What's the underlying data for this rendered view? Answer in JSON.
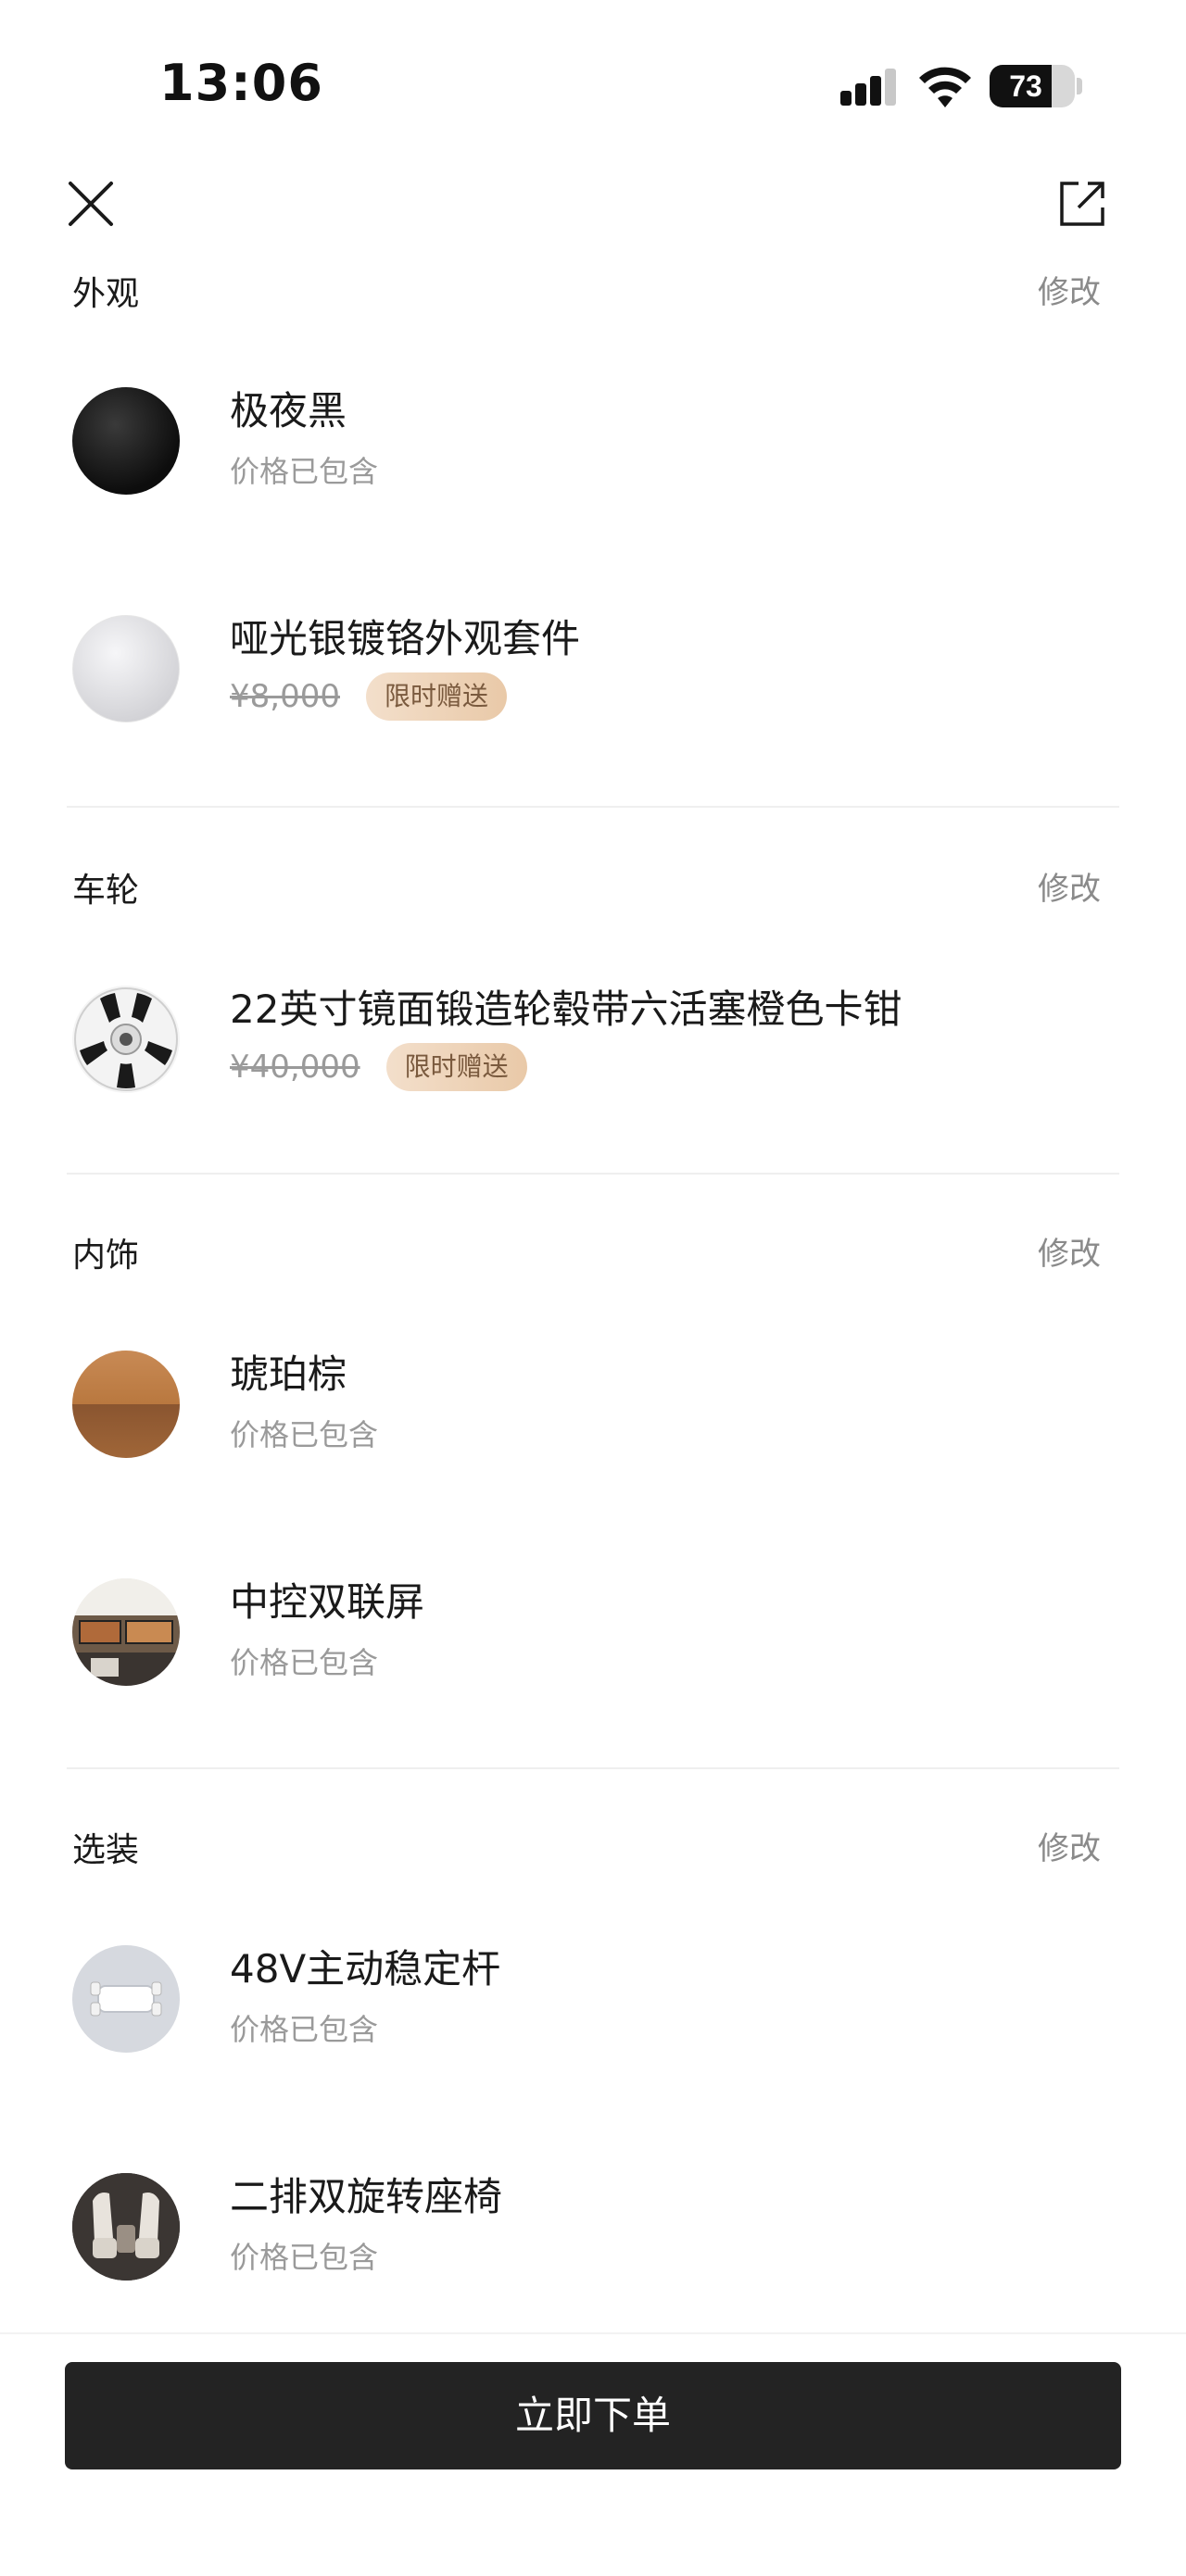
{
  "status_bar": {
    "time": "13:06",
    "battery": "73",
    "battery_level": 0.73
  },
  "nav": {
    "close_icon": "close-icon",
    "share_icon": "share-icon"
  },
  "edit_label": "修改",
  "sections": {
    "exterior": {
      "title": "外观",
      "items": [
        {
          "name": "极夜黑",
          "sub": "价格已包含"
        },
        {
          "name": "哑光银镀铬外观套件",
          "price": "¥8,000",
          "badge": "限时赠送"
        }
      ]
    },
    "wheels": {
      "title": "车轮",
      "items": [
        {
          "name": "22英寸镜面锻造轮毂带六活塞橙色卡钳",
          "price": "¥40,000",
          "badge": "限时赠送"
        }
      ]
    },
    "interior": {
      "title": "内饰",
      "items": [
        {
          "name": "琥珀棕",
          "sub": "价格已包含"
        },
        {
          "name": "中控双联屏",
          "sub": "价格已包含"
        }
      ]
    },
    "options": {
      "title": "选装",
      "items": [
        {
          "name": "48V主动稳定杆",
          "sub": "价格已包含"
        },
        {
          "name": "二排双旋转座椅",
          "sub": "价格已包含"
        }
      ]
    }
  },
  "footer": {
    "order_label": "立即下单"
  },
  "colors": {
    "accent": "#232323",
    "muted": "#9a9a9a",
    "badge_bg": "#efd6bd",
    "badge_text": "#7a5a3e"
  }
}
